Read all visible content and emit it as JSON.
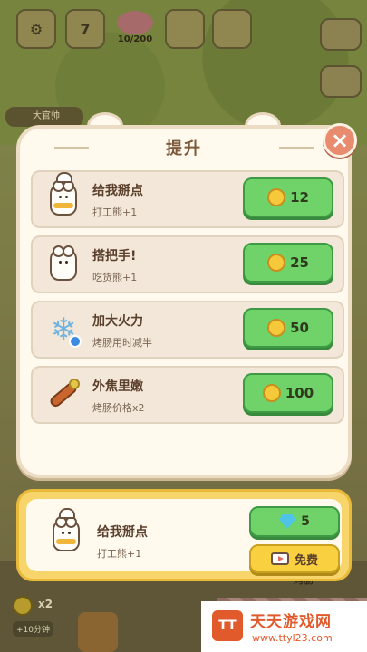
{
  "hud": {
    "pig_counter": "10/200",
    "calendar_day": "7",
    "timer_label": "大官帅",
    "coin_multiplier": "x2",
    "time_bonus": "+10分钟",
    "right_stand_label": "烤肠"
  },
  "panel": {
    "title": "提升",
    "close_symbol": "×"
  },
  "upgrades": [
    {
      "name": "给我掰点",
      "desc": "打工熊+1",
      "price": "12",
      "icon": "chef-bear-icon"
    },
    {
      "name": "搭把手!",
      "desc": "吃货熊+1",
      "price": "25",
      "icon": "bear-icon"
    },
    {
      "name": "加大火力",
      "desc": "烤肠用时减半",
      "price": "50",
      "icon": "snowflake-clock-icon"
    },
    {
      "name": "外焦里嫩",
      "desc": "烤肠价格x2",
      "price": "100",
      "icon": "sausage-icon"
    }
  ],
  "featured": {
    "name": "给我掰点",
    "desc": "打工熊+1",
    "gem_price": "5",
    "free_label": "免费"
  },
  "watermark": {
    "logo": "TT",
    "title": "天天游戏网",
    "url": "www.ttyl23.com"
  },
  "colors": {
    "buy_green": "#6fd36a",
    "free_yellow": "#f8d040",
    "panel_bg": "#fff9ee",
    "close_red": "#e98b6e",
    "title_brown": "#7d5a3c"
  }
}
